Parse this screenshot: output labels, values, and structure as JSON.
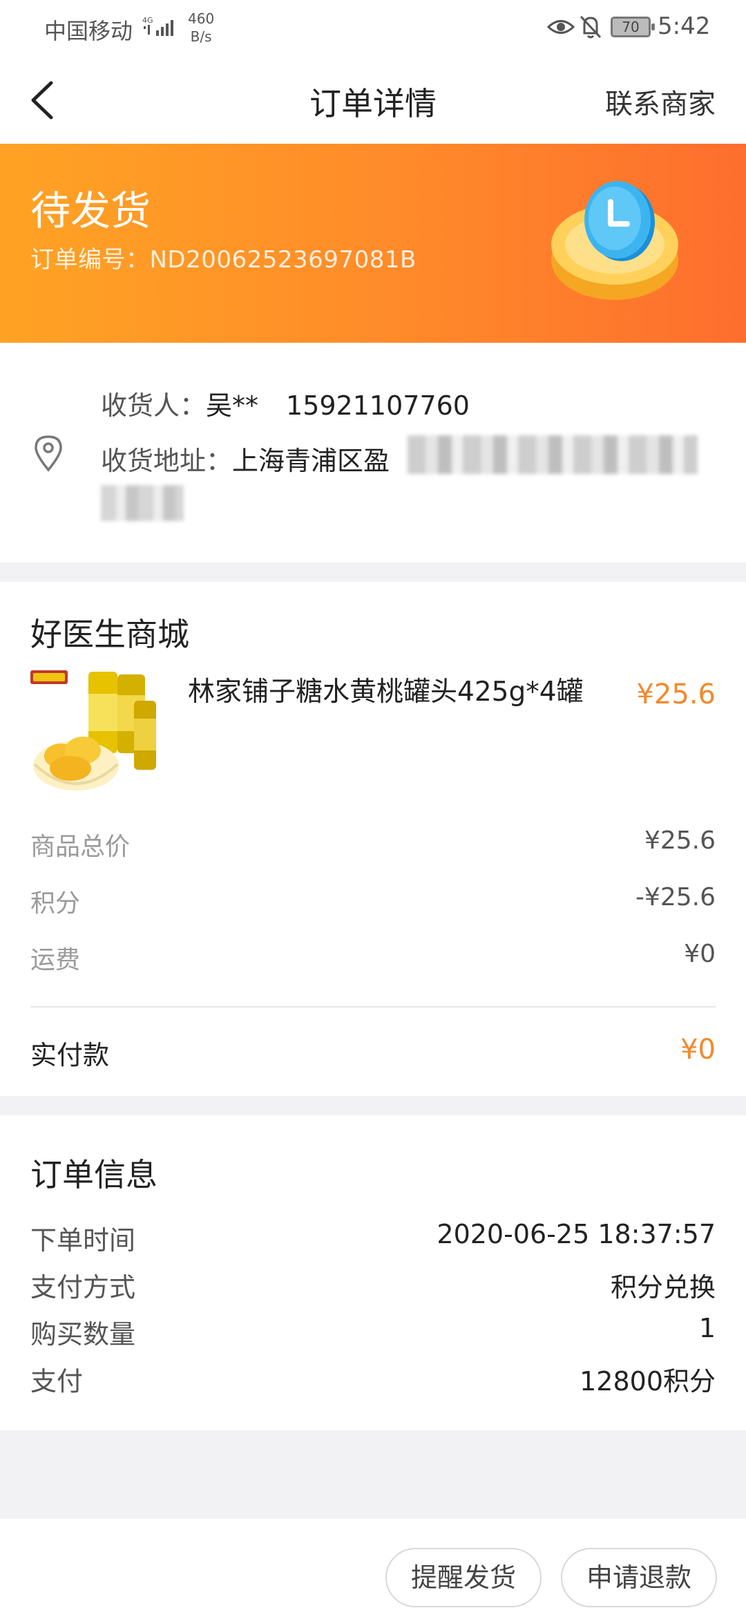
{
  "status_bar": {
    "carrier": "中国移动",
    "network": "4G",
    "speed_value": "460",
    "speed_unit": "B/s",
    "battery": "70",
    "time": "5:42"
  },
  "header": {
    "title": "订单详情",
    "contact_label": "联系商家"
  },
  "banner": {
    "status": "待发货",
    "order_number_label": "订单编号：",
    "order_number": "ND20062523697081B"
  },
  "address": {
    "receiver_label": "收货人：",
    "receiver_name": "吴**",
    "phone": "15921107760",
    "address_label": "收货地址：",
    "address_visible": "上海青浦区盈"
  },
  "product_section": {
    "shop_name": "好医生商城",
    "product_title": "林家铺子糖水黄桃罐头425g*4罐",
    "product_price": "¥25.6",
    "fees": [
      {
        "label": "商品总价",
        "value": "¥25.6"
      },
      {
        "label": "积分",
        "value": "-¥25.6"
      },
      {
        "label": "运费",
        "value": "¥0"
      }
    ],
    "paid_label": "实付款",
    "paid_value": "¥0"
  },
  "order_info": {
    "title": "订单信息",
    "rows": [
      {
        "label": "下单时间",
        "value": "2020-06-25 18:37:57"
      },
      {
        "label": "支付方式",
        "value": "积分兑换"
      },
      {
        "label": "购买数量",
        "value": "1"
      },
      {
        "label": "支付",
        "value": "12800积分"
      }
    ]
  },
  "actions": {
    "remind_label": "提醒发货",
    "refund_label": "申请退款"
  },
  "colors": {
    "accent": "#f08a2c",
    "banner_start": "#ffa324",
    "banner_end": "#fe6e2e"
  },
  "icons": {
    "back": "chevron-left-icon",
    "location": "location-pin-icon",
    "banner": "clock-coin-icon"
  }
}
